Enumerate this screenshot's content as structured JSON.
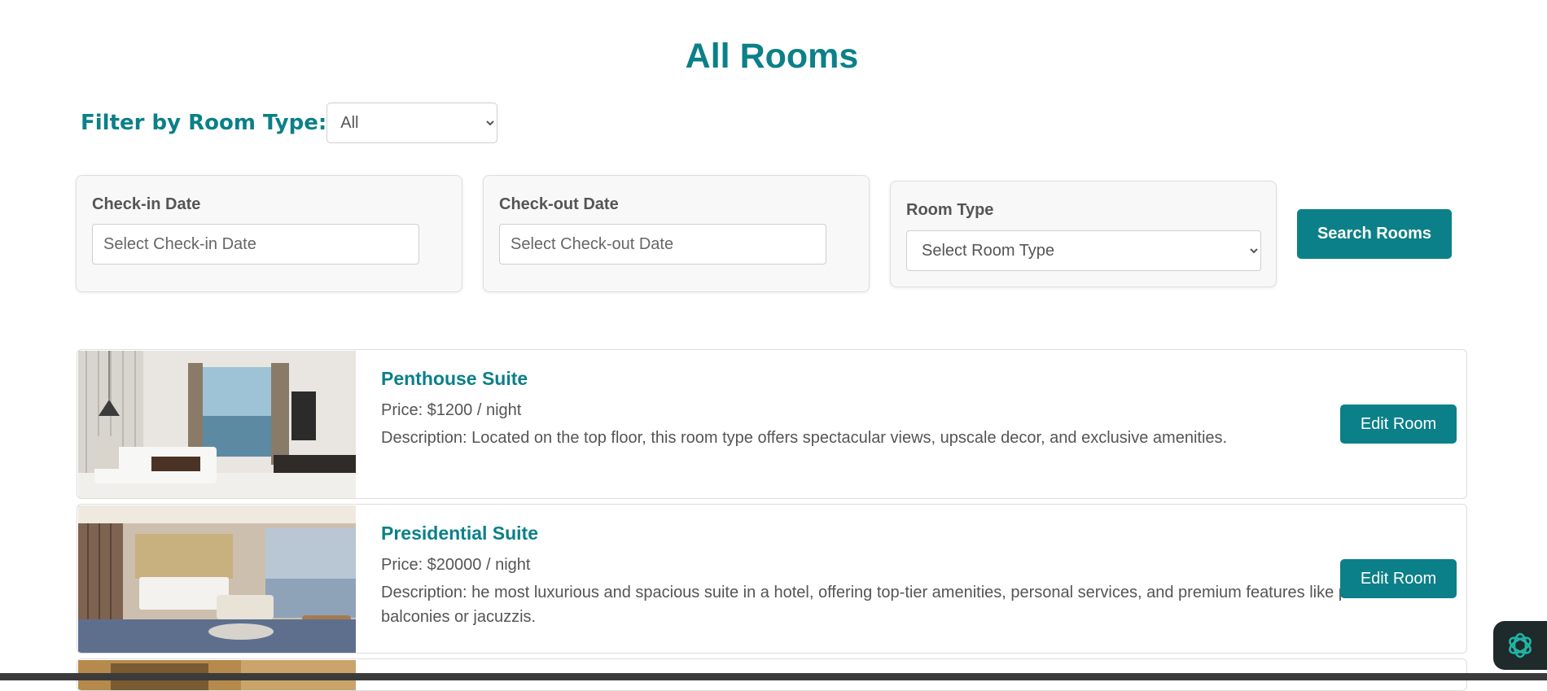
{
  "page": {
    "title": "All Rooms"
  },
  "filter": {
    "label": "Filter by Room Type:",
    "selected": "All"
  },
  "search": {
    "checkin": {
      "label": "Check-in Date",
      "placeholder": "Select Check-in Date"
    },
    "checkout": {
      "label": "Check-out Date",
      "placeholder": "Select Check-out Date"
    },
    "room_type": {
      "label": "Room Type",
      "selected": "Select Room Type"
    },
    "button_label": "Search Rooms"
  },
  "rooms": [
    {
      "name": "Penthouse Suite",
      "price": "Price: $1200 / night",
      "description": "Description: Located on the top floor, this room type offers spectacular views, upscale decor, and exclusive amenities.",
      "button_label": "Edit Room"
    },
    {
      "name": "Presidential Suite",
      "price": "Price: $20000 / night",
      "description": "Description: he most luxurious and spacious suite in a hotel, offering top-tier amenities, personal services, and premium features like private balconies or jacuzzis.",
      "button_label": "Edit Room"
    }
  ],
  "colors": {
    "accent": "#0b8088",
    "text": "#555555",
    "card_bg": "#f8f8f8"
  },
  "icons": {
    "assistant": "openai-logo-icon",
    "select_arrow": "chevron-down-icon"
  }
}
